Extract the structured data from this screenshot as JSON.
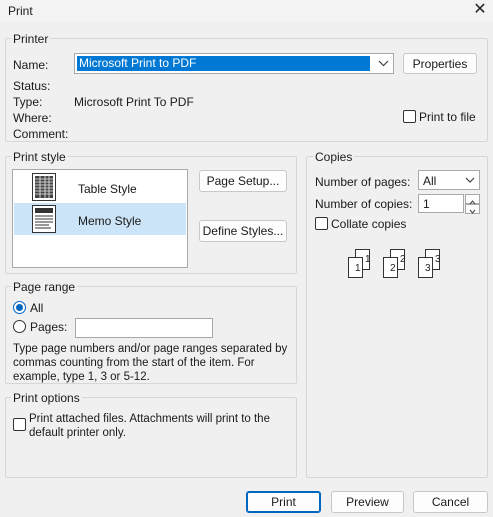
{
  "window": {
    "title": "Print"
  },
  "printer": {
    "group_label": "Printer",
    "name_label": "Name:",
    "name_value": "Microsoft Print to PDF",
    "properties_label": "Properties",
    "status_label": "Status:",
    "type_label": "Type:",
    "type_value": "Microsoft Print To PDF",
    "where_label": "Where:",
    "comment_label": "Comment:",
    "print_to_file_label": "Print to file",
    "print_to_file_checked": false
  },
  "print_style": {
    "group_label": "Print style",
    "items": [
      {
        "label": "Table Style",
        "selected": false
      },
      {
        "label": "Memo Style",
        "selected": true
      }
    ],
    "page_setup_label": "Page Setup...",
    "define_styles_label": "Define Styles..."
  },
  "copies": {
    "group_label": "Copies",
    "number_of_pages_label": "Number of pages:",
    "number_of_pages_value": "All",
    "number_of_copies_label": "Number of copies:",
    "number_of_copies_value": "1",
    "collate_label": "Collate copies",
    "collate_checked": false,
    "collate_pages": [
      "1",
      "1",
      "2",
      "2",
      "3",
      "3"
    ]
  },
  "page_range": {
    "group_label": "Page range",
    "all_label": "All",
    "pages_label": "Pages:",
    "pages_value": "",
    "selected": "All",
    "help_text": "Type page numbers and/or page ranges separated by commas counting from the start of the item.  For example, type 1, 3 or 5-12."
  },
  "print_options": {
    "group_label": "Print options",
    "attached_label": "Print attached files.  Attachments will print to the default printer only.",
    "attached_checked": false
  },
  "footer": {
    "print_label": "Print",
    "preview_label": "Preview",
    "cancel_label": "Cancel"
  },
  "colors": {
    "accent": "#0067c0",
    "selection": "#0078d4",
    "list_selection": "#cce4f7",
    "dialog_bg": "#f0f0f0"
  }
}
